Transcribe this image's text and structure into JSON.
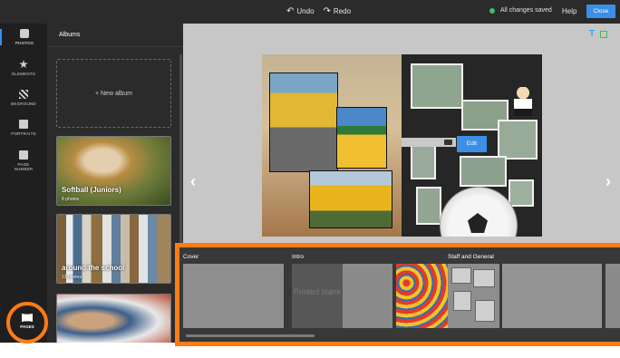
{
  "topbar": {
    "undo_label": "Undo",
    "redo_label": "Redo",
    "save_status": "All changes saved",
    "help_label": "Help",
    "close_label": "Close",
    "undo_icon": "undo-icon",
    "redo_icon": "redo-icon"
  },
  "rail": {
    "items": [
      {
        "label": "PHOTOS",
        "icon": "photos-icon",
        "active": true
      },
      {
        "label": "ELEMENTS",
        "icon": "star-icon"
      },
      {
        "label": "BKGROUND",
        "icon": "background-icon"
      },
      {
        "label": "PORTRAITS",
        "icon": "portrait-icon"
      },
      {
        "label": "PAGE NUMBER",
        "icon": "page-number-icon"
      }
    ],
    "pages_label": "PAGES"
  },
  "albums": {
    "title": "Albums",
    "new_album_label": "+ New album",
    "cards": [
      {
        "name": "Softball (Juniors)",
        "count": "8 photos"
      },
      {
        "name": "around the school",
        "count": "12 photos"
      }
    ]
  },
  "editor": {
    "edit_label": "Edit",
    "text_tool": "T",
    "colors": {
      "accent": "#3b8fe6",
      "highlight": "#ff7b14",
      "saved_dot": "#37c25e"
    }
  },
  "pages_strip": {
    "sections": [
      {
        "label": "Cover"
      },
      {
        "label": "Intro"
      },
      {
        "label": "Staff and General"
      }
    ],
    "blank_page_label": "Printed blank"
  }
}
